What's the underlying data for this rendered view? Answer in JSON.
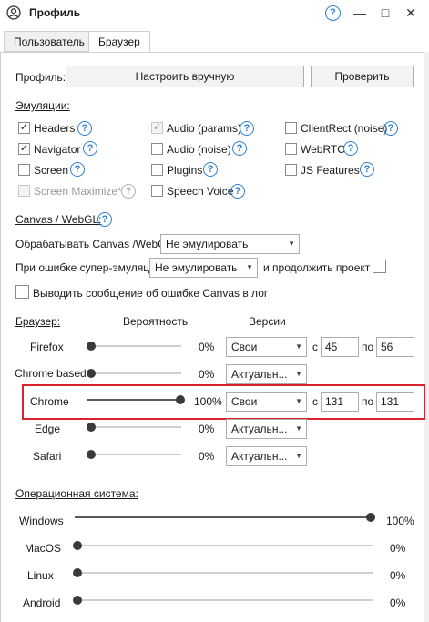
{
  "window": {
    "title": "Профиль",
    "help": "?",
    "minimize": "—",
    "maximize": "□",
    "close": "✕"
  },
  "tabs": [
    "Пользователь",
    "Браузер"
  ],
  "profile": {
    "label": "Профиль:",
    "value": "Настроить вручную",
    "check_button": "Проверить"
  },
  "emulation": {
    "heading": "Эмуляции:",
    "items": [
      {
        "label": "Headers",
        "checked": true
      },
      {
        "label": "Audio (params)",
        "checked": true
      },
      {
        "label": "ClientRect (noise)",
        "checked": false
      },
      {
        "label": "Navigator",
        "checked": true
      },
      {
        "label": "Audio (noise)",
        "checked": false
      },
      {
        "label": "WebRTC",
        "checked": false
      },
      {
        "label": "Screen",
        "checked": false
      },
      {
        "label": "Plugins",
        "checked": false
      },
      {
        "label": "JS Features",
        "checked": false
      },
      {
        "label": "Screen Maximize*",
        "checked": false,
        "disabled": true
      },
      {
        "label": "Speech Voice",
        "checked": false
      }
    ]
  },
  "canvas": {
    "heading": "Canvas / WebGL:",
    "process_label": "Обрабатывать Canvas /WebGL",
    "process_value": "Не эмулировать",
    "error_label": "При ошибке супер-эмуляции",
    "error_value": "Не эмулировать",
    "continue_label": "и продолжить проект",
    "log_label": "Выводить сообщение об ошибке Canvas в лог"
  },
  "browser": {
    "heading": "Браузер:",
    "col_probability": "Вероятность",
    "col_versions": "Версии",
    "from_label": "с",
    "to_label": "по",
    "rows": [
      {
        "name": "Firefox",
        "prob": 0,
        "prob_text": "0%",
        "version_mode": "Свои",
        "from": "45",
        "to": "56"
      },
      {
        "name": "Chrome based",
        "prob": 0,
        "prob_text": "0%",
        "version_mode": "Актуальн..."
      },
      {
        "name": "Chrome",
        "prob": 100,
        "prob_text": "100%",
        "version_mode": "Свои",
        "from": "131",
        "to": "131"
      },
      {
        "name": "Edge",
        "prob": 0,
        "prob_text": "0%",
        "version_mode": "Актуальн..."
      },
      {
        "name": "Safari",
        "prob": 0,
        "prob_text": "0%",
        "version_mode": "Актуальн..."
      }
    ]
  },
  "os": {
    "heading": "Операционная система:",
    "rows": [
      {
        "name": "Windows",
        "prob": 100,
        "prob_text": "100%"
      },
      {
        "name": "MacOS",
        "prob": 0,
        "prob_text": "0%"
      },
      {
        "name": "Linux",
        "prob": 0,
        "prob_text": "0%"
      },
      {
        "name": "Android",
        "prob": 0,
        "prob_text": "0%"
      }
    ]
  },
  "colors": {
    "accent": "#2f7fd4",
    "highlight": "#d9232e"
  },
  "icons": {
    "app": "user-circle-icon",
    "help": "question-circle-icon",
    "dropdown": "chevron-down-icon"
  }
}
